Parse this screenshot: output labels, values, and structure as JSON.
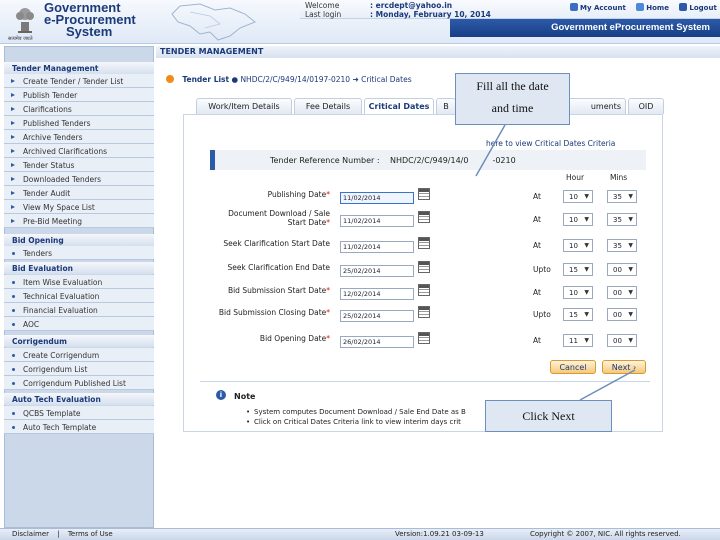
{
  "header": {
    "brand_line1": "Government",
    "brand_line2": "e-Procurement",
    "brand_line3": "System",
    "emblem_caption": "सत्यमेव जयते",
    "welcome_label": "Welcome",
    "welcome_value": ": ercdept@yahoo.in",
    "last_login_label": "Last login",
    "last_login_value": ": Monday, February 10, 2014",
    "nav": [
      "My Account",
      "Home",
      "Logout"
    ],
    "system_title": "Government eProcurement System"
  },
  "sidebar": {
    "sections": [
      {
        "title": "Tender Management",
        "items": [
          "Create Tender / Tender List",
          "Publish Tender",
          "Clarifications",
          "Published Tenders",
          "Archive Tenders",
          "Archived Clarifications",
          "Tender Status",
          "Downloaded Tenders",
          "Tender Audit",
          "View My Space List",
          "Pre-Bid Meeting"
        ]
      },
      {
        "title": "Bid Opening",
        "items": [
          "Tenders"
        ]
      },
      {
        "title": "Bid Evaluation",
        "items": [
          "Item Wise Evaluation",
          "Technical Evaluation",
          "Financial Evaluation",
          "AOC"
        ]
      },
      {
        "title": "Corrigendum",
        "items": [
          "Create Corrigendum",
          "Corrigendum List",
          "Corrigendum Published List"
        ]
      },
      {
        "title": "Auto Tech Evaluation",
        "items": [
          "QCBS Template",
          "Auto Tech Template"
        ]
      }
    ]
  },
  "main": {
    "header": "TENDER MANAGEMENT",
    "breadcrumb": {
      "root": "Tender List",
      "middle": "NHDC/2/C/949/14/0197-0210",
      "current": "Critical Dates"
    },
    "tabs": [
      "Work/Item Details",
      "Fee Details",
      "Critical Dates",
      "B",
      "uments",
      "OID"
    ],
    "active_tab": "Critical Dates",
    "criteria_link": "here to view Critical Dates Criteria",
    "reference_label": "Tender Reference Number :",
    "reference_value": "NHDC/2/C/949/14/0",
    "reference_suffix": "-0210",
    "col_hour": "Hour",
    "col_mins": "Mins",
    "rows": [
      {
        "label": "Publishing Date",
        "required": "*",
        "date": "11/02/2014",
        "prefix": "At",
        "hour": "10",
        "mins": "35"
      },
      {
        "label": "Document Download / Sale Start Date",
        "required": "*",
        "date": "11/02/2014",
        "prefix": "At",
        "hour": "10",
        "mins": "35"
      },
      {
        "label": "Seek Clarification Start Date",
        "required": "",
        "date": "11/02/2014",
        "prefix": "At",
        "hour": "10",
        "mins": "35"
      },
      {
        "label": "Seek Clarification End Date",
        "required": "",
        "date": "25/02/2014",
        "prefix": "Upto",
        "hour": "15",
        "mins": "00"
      },
      {
        "label": "Bid Submission Start Date",
        "required": "*",
        "date": "12/02/2014",
        "prefix": "At",
        "hour": "10",
        "mins": "00"
      },
      {
        "label": "Bid Submission Closing Date",
        "required": "*",
        "date": "25/02/2014",
        "prefix": "Upto",
        "hour": "15",
        "mins": "00"
      },
      {
        "label": "Bid Opening Date",
        "required": "*",
        "date": "26/02/2014",
        "prefix": "At",
        "hour": "11",
        "mins": "00"
      }
    ],
    "cancel_label": "Cancel",
    "next_label": "Next",
    "note_title": "Note",
    "note_lines": [
      "System computes Document Download / Sale End Date as B",
      "Click on Critical Dates Criteria link to view interim days crit"
    ]
  },
  "callouts": {
    "date_line1": "Fill all the date",
    "date_line2": "and time",
    "next": "Click Next"
  },
  "footer": {
    "disclaimer": "Disclaimer",
    "separator": "|",
    "terms": "Terms of Use",
    "version": "Version:1.09.21 03-09-13",
    "copyright": "Copyright © 2007, NIC. All rights reserved."
  },
  "colors": {
    "brand": "#1b3a7a",
    "accent": "#2d5aa8",
    "button": "#f6c879"
  }
}
